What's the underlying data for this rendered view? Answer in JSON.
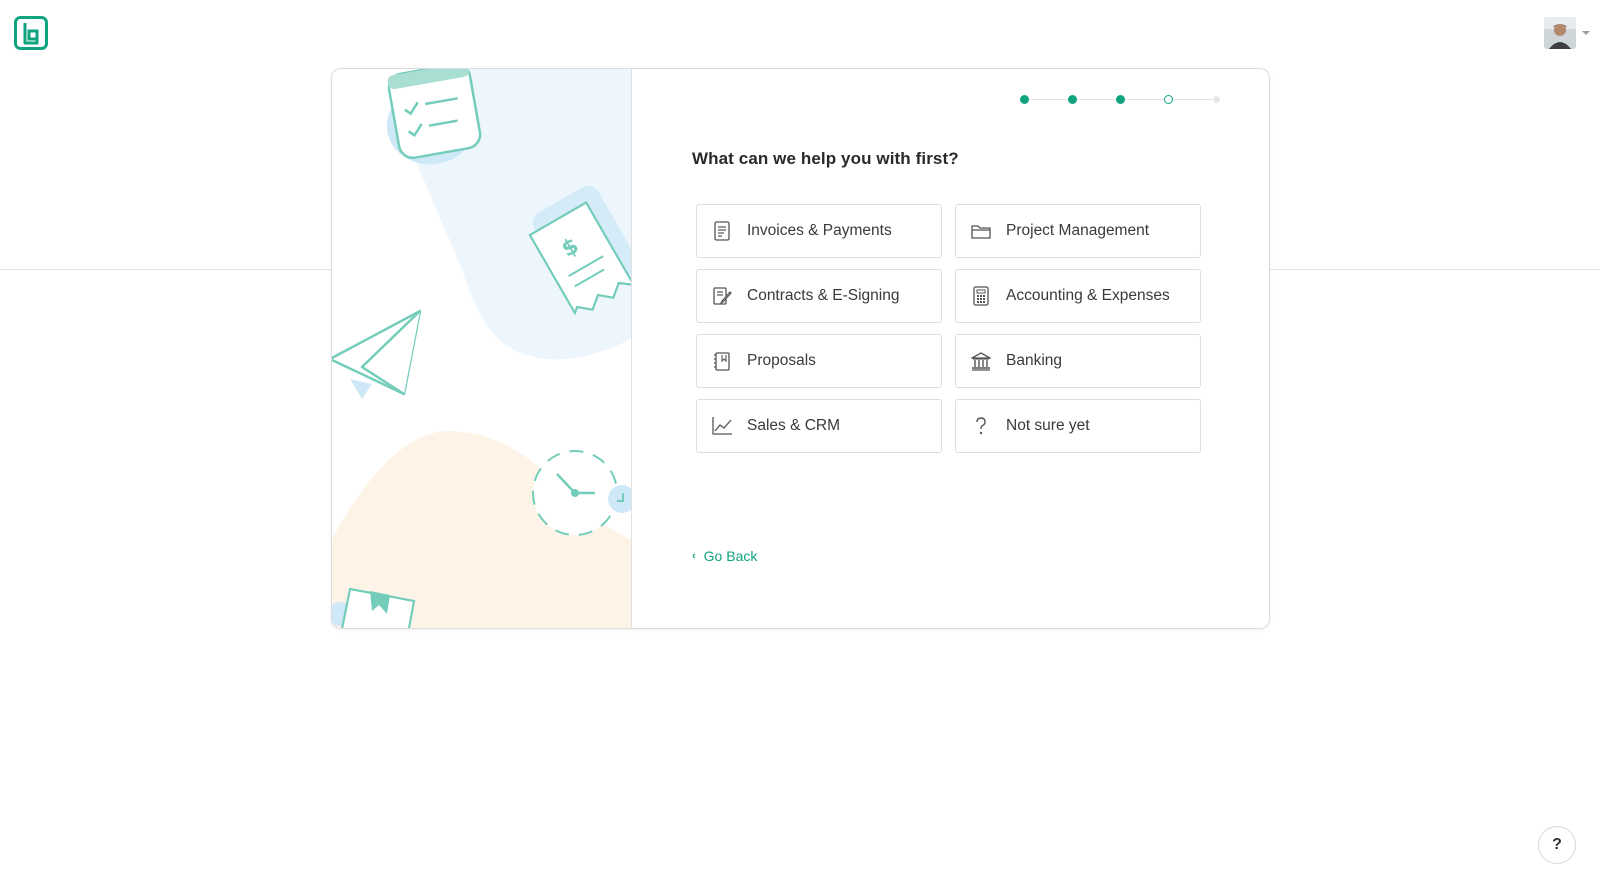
{
  "header": {
    "logo_icon": "brand-logo-icon",
    "avatar_icon": "user-avatar"
  },
  "onboarding": {
    "question": "What can we help you with first?",
    "progress": {
      "total_steps": 5,
      "completed_steps": 3,
      "current_step": 4
    },
    "options": [
      {
        "label": "Invoices & Payments",
        "icon": "invoice-icon"
      },
      {
        "label": "Project Management",
        "icon": "folder-icon"
      },
      {
        "label": "Contracts & E-Signing",
        "icon": "contract-sign-icon"
      },
      {
        "label": "Accounting & Expenses",
        "icon": "calculator-icon"
      },
      {
        "label": "Proposals",
        "icon": "proposal-icon"
      },
      {
        "label": "Banking",
        "icon": "bank-icon"
      },
      {
        "label": "Sales & CRM",
        "icon": "chart-line-icon"
      },
      {
        "label": "Not sure yet",
        "icon": "question-icon"
      }
    ],
    "go_back_label": "Go Back"
  },
  "help_button_label": "?",
  "colors": {
    "accent": "#0fa37f",
    "illustration_teal": "#74cdbb",
    "illustration_blue": "#eef6fd",
    "illustration_peach": "#fdf3e6"
  }
}
